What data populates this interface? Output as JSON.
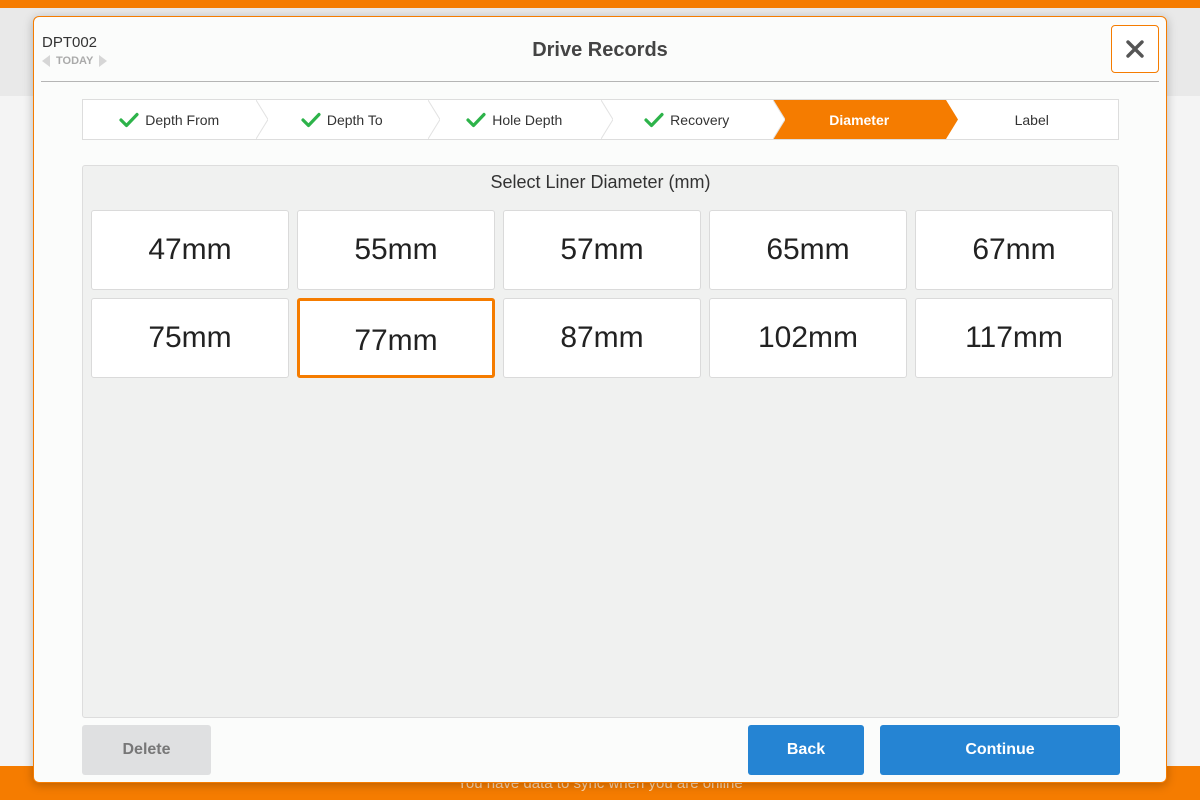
{
  "background": {
    "sync_message": "You have data to sync when you are online"
  },
  "header": {
    "record_id": "DPT002",
    "date_label": "TODAY",
    "title": "Drive Records",
    "close_icon": "close-icon"
  },
  "steps": [
    {
      "label": "Depth From",
      "completed": true
    },
    {
      "label": "Depth To",
      "completed": true
    },
    {
      "label": "Hole Depth",
      "completed": true
    },
    {
      "label": "Recovery",
      "completed": true
    },
    {
      "label": "Diameter",
      "active": true
    },
    {
      "label": "Label"
    }
  ],
  "panel": {
    "title": "Select Liner Diameter (mm)",
    "options": [
      "47mm",
      "55mm",
      "57mm",
      "65mm",
      "67mm",
      "75mm",
      "77mm",
      "87mm",
      "102mm",
      "117mm"
    ],
    "selected": "77mm"
  },
  "footer": {
    "delete_label": "Delete",
    "back_label": "Back",
    "continue_label": "Continue"
  },
  "colors": {
    "accent": "#f57c00",
    "primary_button": "#2584d3",
    "check": "#2db34a"
  }
}
